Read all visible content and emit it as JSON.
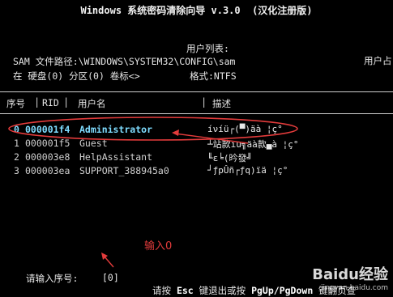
{
  "title": "Windows 系统密码清除向导 v.3.0  (汉化注册版)",
  "userlist_label": "用户列表:",
  "user_right_label": "用户占",
  "sam_path": "SAM 文件路径:\\WINDOWS\\SYSTEM32\\CONFIG\\sam",
  "disk_line": "在 硬盘(0) 分区(0) 卷标<>",
  "format_label": "格式:NTFS",
  "columns": {
    "index": "序号",
    "rid": "RID",
    "username": "用户名",
    "desc": "描述"
  },
  "rows": [
    {
      "index": "0",
      "rid": "000001f4",
      "name": "Administrator",
      "desc": "íνíü┌(▀)äà ¦ç°"
    },
    {
      "index": "1",
      "rid": "000001f5",
      "name": "Guest",
      "desc": "┴站款ïu╗äà款▄à ¦ç°"
    },
    {
      "index": "2",
      "rid": "000003e8",
      "name": "HelpAssistant",
      "desc": "╙ε╘(昑發╝"
    },
    {
      "index": "3",
      "rid": "000003ea",
      "name": "SUPPORT_388945a0",
      "desc": "┘ƒpÛñ┌ƒq)ïä ¦ç°"
    }
  ],
  "annotation": "输入0",
  "prompt_label": "请输入序号:",
  "prompt_value": "[0]",
  "footer": {
    "p1": "请按 ",
    "k1": "Esc",
    "p2": " 键退出或按 ",
    "k2": "PgUp/PgDown",
    "p3": " 键翻页查"
  },
  "watermark": {
    "brand": "Baidu经验",
    "url": "jingyan.baidu.com"
  },
  "colors": {
    "selected_row": "#7fdcff",
    "annotation": "#e23b3b"
  }
}
